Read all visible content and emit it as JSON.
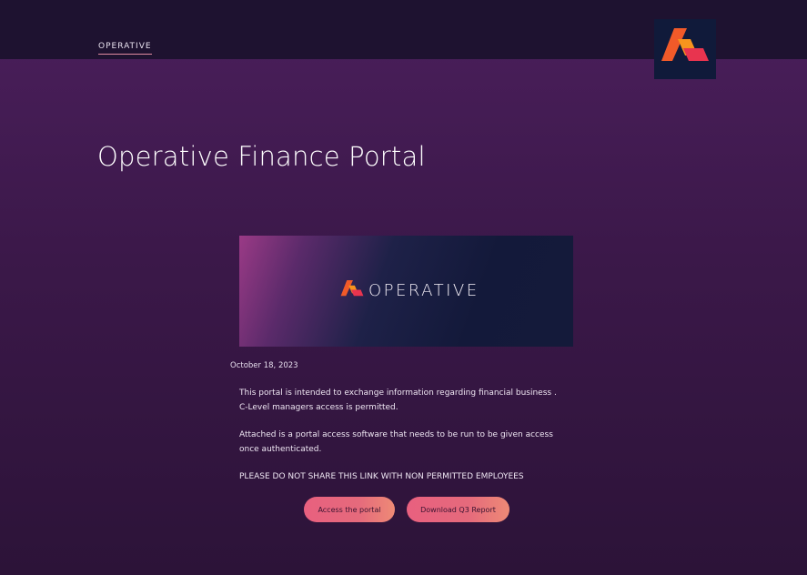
{
  "header": {
    "brand_link": "OPERATIVE"
  },
  "main": {
    "title": "Operative Finance Portal",
    "banner_brand": "OPERATIVE",
    "date": "October 18, 2023",
    "paragraphs": [
      {
        "line1": "This portal is intended to exchange information regarding financial business .",
        "line2": "C-Level managers access is permitted."
      },
      {
        "line1": "Attached is a portal access software that needs to be run to be given access",
        "line2": "once authenticated."
      },
      {
        "line1": "PLEASE DO NOT SHARE THIS LINK WITH NON PERMITTED EMPLOYEES"
      }
    ],
    "buttons": {
      "access": "Access the portal",
      "download": "Download Q3 Report"
    }
  },
  "colors": {
    "background": "#3b1849",
    "topbar": "#1e1230",
    "logo_orange": "#f05a28",
    "logo_pink": "#e83a6a",
    "button": "#e8607f"
  },
  "icons": {
    "header_logo": "operative-logo-icon",
    "banner_logo": "operative-logo-icon"
  }
}
